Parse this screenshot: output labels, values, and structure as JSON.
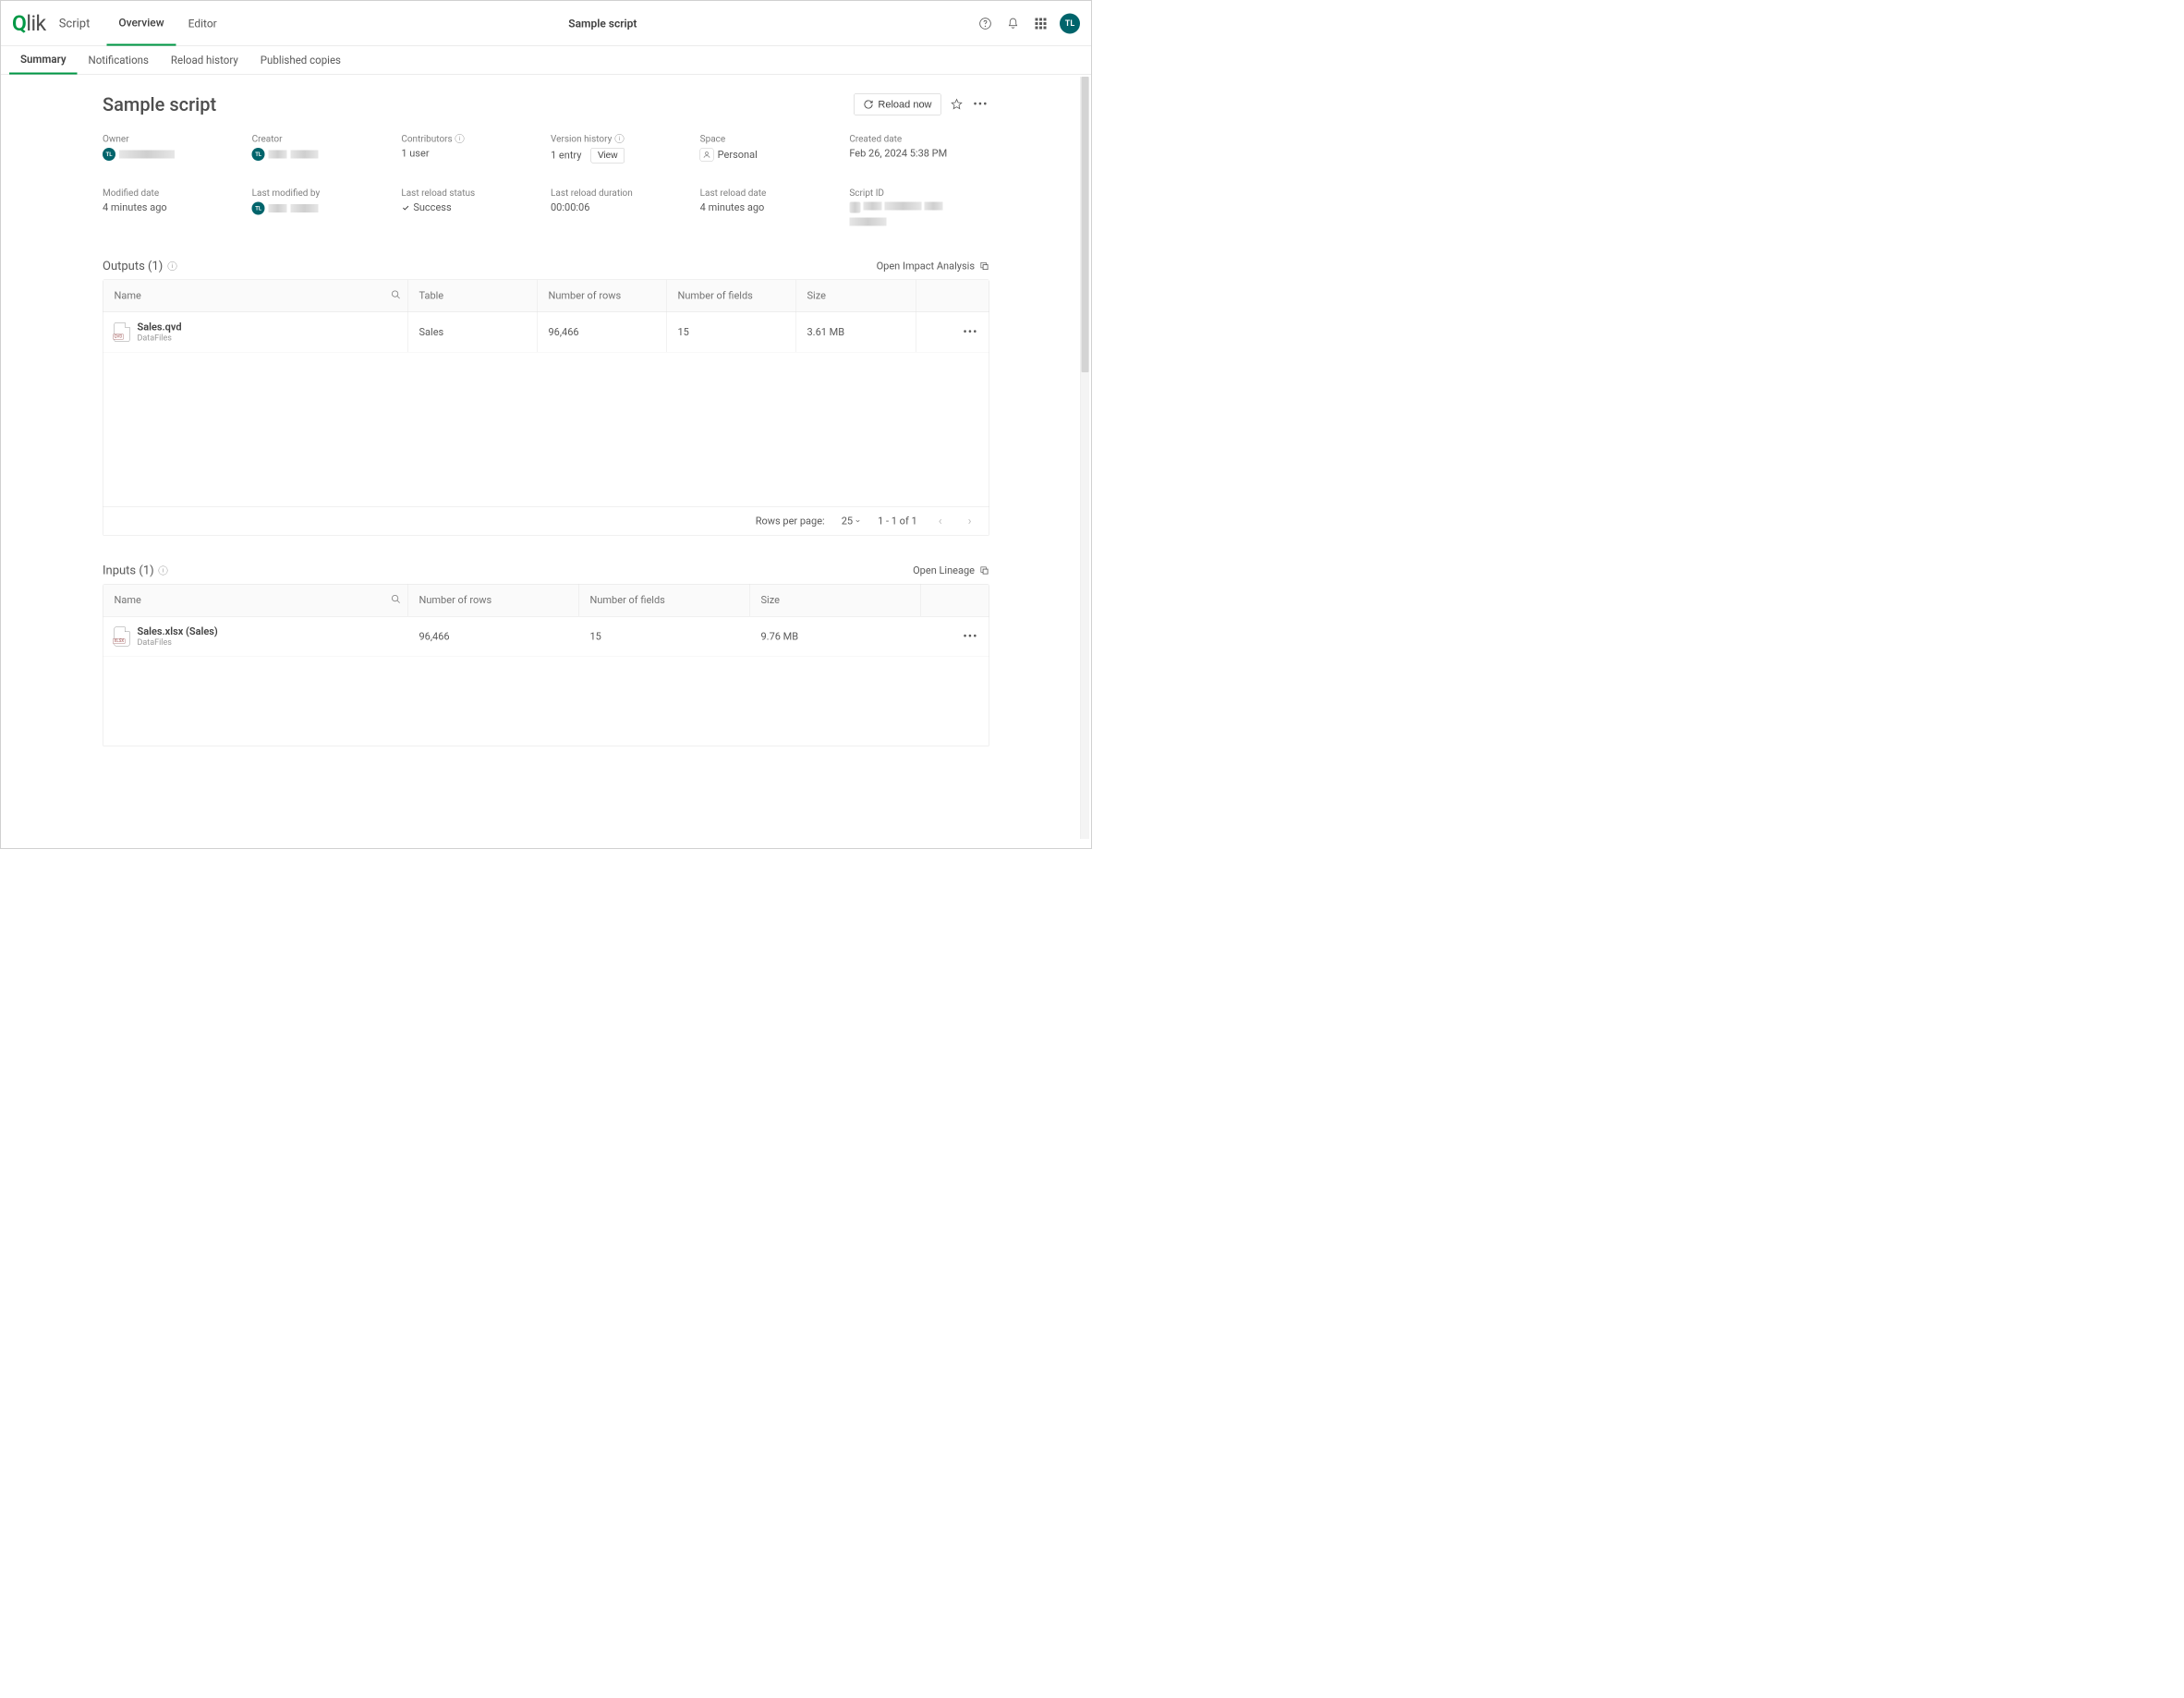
{
  "brand": {
    "logo_text_q": "Q",
    "logo_text_rest": "lik"
  },
  "header": {
    "script_label": "Script",
    "tabs": {
      "overview": "Overview",
      "editor": "Editor"
    },
    "title": "Sample script",
    "avatar_initials": "TL"
  },
  "subtabs": {
    "summary": "Summary",
    "notifications": "Notifications",
    "reload_history": "Reload history",
    "published_copies": "Published copies"
  },
  "page": {
    "title": "Sample script",
    "reload_now": "Reload now"
  },
  "meta": {
    "owner_label": "Owner",
    "owner_initials": "TL",
    "creator_label": "Creator",
    "creator_initials": "TL",
    "contributors_label": "Contributors",
    "contributors_value": "1 user",
    "version_label": "Version history",
    "version_value": "1 entry",
    "version_view": "View",
    "space_label": "Space",
    "space_value": "Personal",
    "created_label": "Created date",
    "created_value": "Feb 26, 2024 5:38 PM",
    "modified_label": "Modified date",
    "modified_value": "4 minutes ago",
    "lastmodby_label": "Last modified by",
    "lastmodby_initials": "TL",
    "lastreloadstatus_label": "Last reload status",
    "lastreloadstatus_value": "Success",
    "lastreloadduration_label": "Last reload duration",
    "lastreloadduration_value": "00:00:06",
    "lastreloaddate_label": "Last reload date",
    "lastreloaddate_value": "4 minutes ago",
    "scriptid_label": "Script ID"
  },
  "outputs": {
    "title": "Outputs (1)",
    "link": "Open Impact Analysis",
    "cols": {
      "name": "Name",
      "table": "Table",
      "rows": "Number of rows",
      "fields": "Number of fields",
      "size": "Size"
    },
    "row": {
      "name": "Sales.qvd",
      "sub": "DataFiles",
      "filetag": "QVD",
      "table": "Sales",
      "rows": "96,466",
      "fields": "15",
      "size": "3.61 MB"
    },
    "footer": {
      "rpp_label": "Rows per page:",
      "rpp_value": "25",
      "range": "1 - 1 of 1"
    }
  },
  "inputs": {
    "title": "Inputs (1)",
    "link": "Open Lineage",
    "cols": {
      "name": "Name",
      "rows": "Number of rows",
      "fields": "Number of fields",
      "size": "Size"
    },
    "row": {
      "name": "Sales.xlsx (Sales)",
      "sub": "DataFiles",
      "filetag": "XLSX",
      "rows": "96,466",
      "fields": "15",
      "size": "9.76 MB"
    }
  }
}
